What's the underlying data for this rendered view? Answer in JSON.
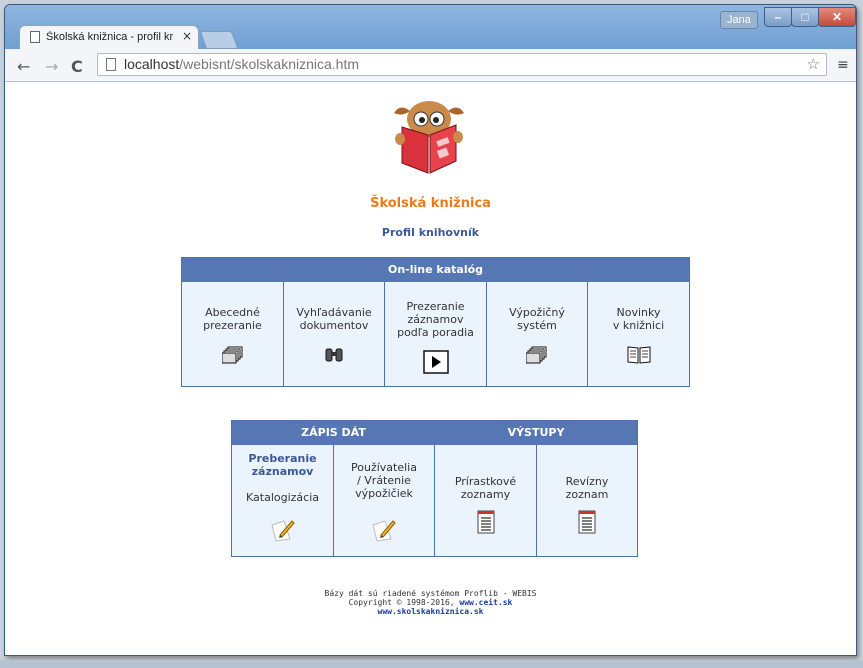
{
  "browser": {
    "tab_title": "Školská knižnica - profil kr",
    "tab_close": "×",
    "user": "Jana",
    "min": "–",
    "max": "□",
    "close": "✕",
    "back": "←",
    "forward": "→",
    "reload": "C",
    "url_host": "localhost",
    "url_path": "/webisnt/skolskakniznica.htm",
    "star": "☆",
    "menu": "≡"
  },
  "page": {
    "title": "Školská knižnica",
    "subtitle": "Profil knihovník",
    "catalog": {
      "header": "On-line katalóg",
      "items": [
        {
          "lines": [
            "Abecedné",
            "prezeranie"
          ],
          "icon": "cards-icon"
        },
        {
          "lines": [
            "Vyhľadávanie",
            "dokumentov"
          ],
          "icon": "binoculars-icon"
        },
        {
          "lines": [
            "Prezeranie",
            "záznamov",
            "podľa poradia"
          ],
          "icon": "play-icon"
        },
        {
          "lines": [
            "Výpožičný",
            "systém"
          ],
          "icon": "cards-icon"
        },
        {
          "lines": [
            "Novinky",
            "v knižnici"
          ],
          "icon": "book-icon"
        }
      ]
    },
    "entry": {
      "header_left": "ZÁPIS DÁT",
      "header_right": "VÝSTUPY",
      "items": [
        {
          "bold": [
            "Preberanie",
            "záznamov"
          ],
          "lines": [
            "Katalogizácia"
          ],
          "icon": "pencil-icon"
        },
        {
          "lines": [
            "Používatelia",
            "/ Vrátenie",
            "výpožičiek"
          ],
          "icon": "pencil-icon"
        },
        {
          "lines": [
            "Prírastkové",
            "zoznamy"
          ],
          "icon": "list-icon"
        },
        {
          "lines": [
            "Revízny",
            "zoznam"
          ],
          "icon": "list-icon"
        }
      ]
    },
    "footer": {
      "line1": "Bázy dát sú riadené systémom Proflib - WEBIS",
      "line2_prefix": "Copyright © 1998-2016, ",
      "line2_link": "www.ceit.sk",
      "line3": "www.skolskakniznica.sk"
    }
  },
  "colors": {
    "accent": "#f07a1a",
    "header_blue": "#5676b4",
    "cell_bg": "#ebf4fd",
    "link": "#3b5998"
  }
}
